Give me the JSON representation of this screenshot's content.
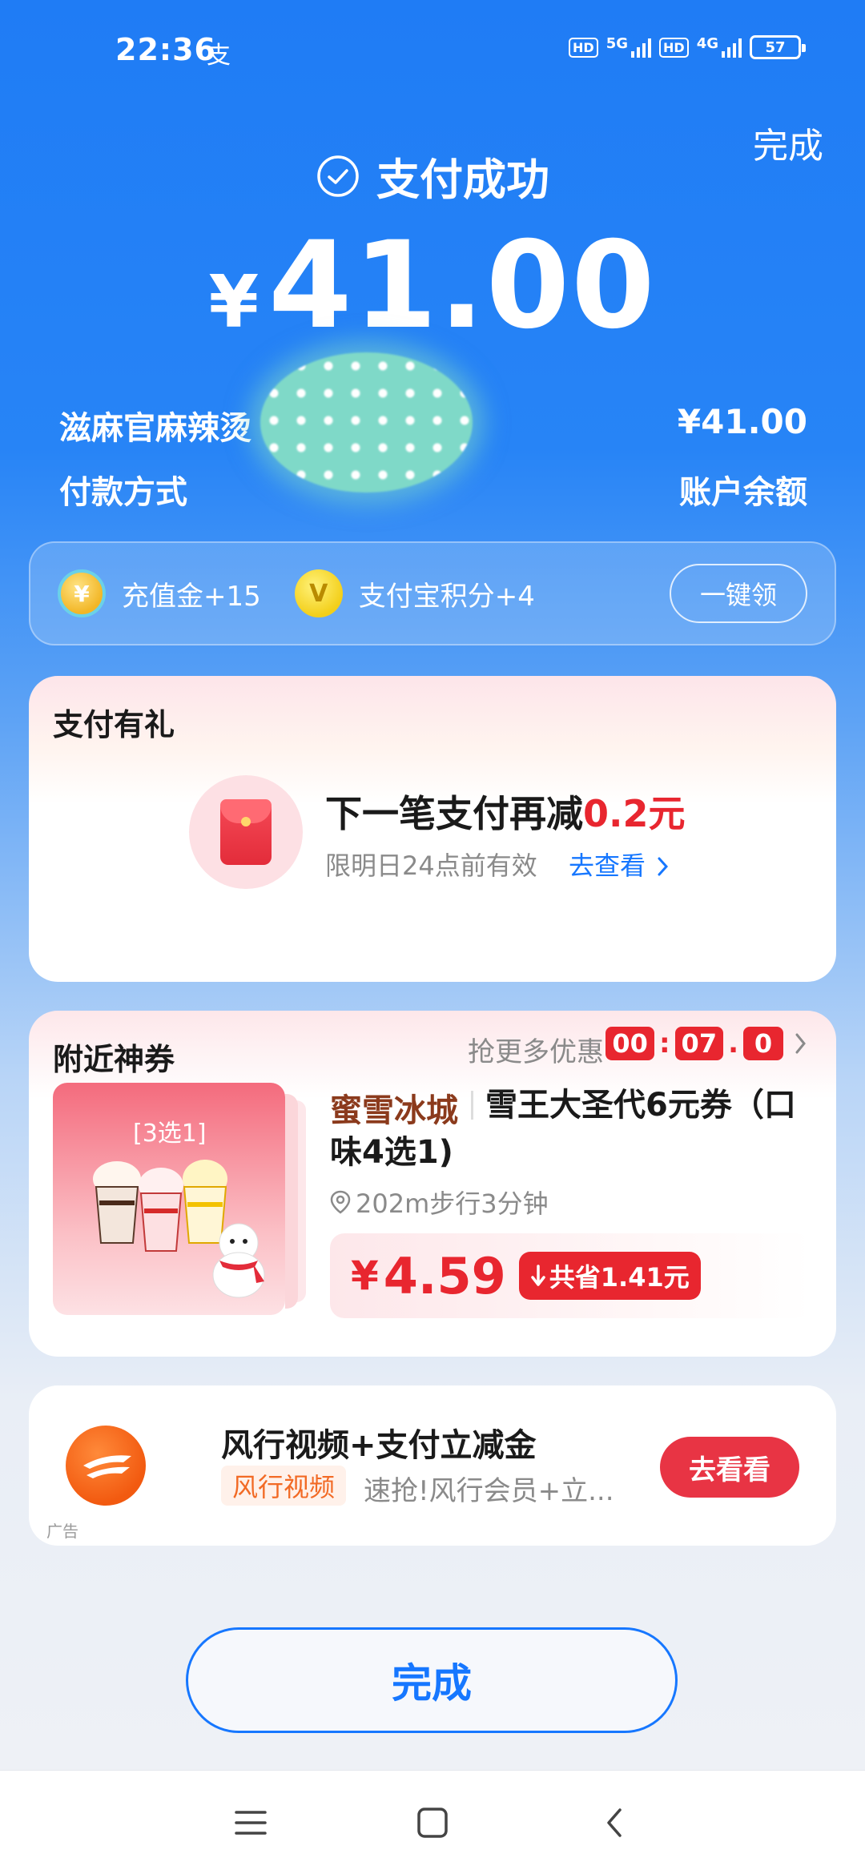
{
  "status_bar": {
    "time": "22:36",
    "app_indicator": "支",
    "hd1": "HD",
    "net1": "5G",
    "hd2": "HD",
    "net2": "4G",
    "battery": "57"
  },
  "header": {
    "done_label": "完成",
    "success_text": "支付成功",
    "currency_symbol": "¥",
    "amount": "41.00"
  },
  "details": {
    "merchant": "滋麻官麻辣烫",
    "paid_amount": "¥41.00",
    "pay_method_label": "付款方式",
    "pay_method_value": "账户余额"
  },
  "rewards": {
    "coin_icon_text": "¥",
    "recharge_text": "充值金+15",
    "points_icon_text": "V",
    "points_text": "支付宝积分+4",
    "claim_label": "一键领"
  },
  "gift_card": {
    "title": "支付有礼",
    "main_prefix": "下一笔支付再减",
    "main_highlight": "0.2元",
    "validity": "限明日24点前有效",
    "link": "去查看"
  },
  "coupon_card": {
    "title": "附近神券",
    "more_deals": "抢更多优惠",
    "timer": {
      "h": "00",
      "m": "07",
      "s": "0"
    },
    "product_tag": "[3选1]",
    "brand": "蜜雪冰城",
    "product_title_line1": "雪王大圣代6元券（口",
    "product_title_line2": "味4选1)",
    "distance": "202m步行3分钟",
    "price_symbol": "¥",
    "price": "4.59",
    "savings": "共省1.41元"
  },
  "ad_card": {
    "title": "风行视频+支付立减金",
    "tag": "风行视频",
    "desc": "速抢!风行会员+立...",
    "ad_flag": "广告",
    "button": "去看看"
  },
  "footer": {
    "done_label": "完成"
  },
  "colors": {
    "primary_blue": "#1677ff",
    "header_blue": "#1f7cf5",
    "accent_red": "#e8262f",
    "brand_brown": "#8b3a1c",
    "ad_orange": "#f26a25"
  },
  "icons": [
    "check-circle-icon",
    "coin-icon",
    "points-icon",
    "red-envelope-icon",
    "chevron-right-icon",
    "location-pin-icon",
    "down-arrow-icon",
    "menu-icon",
    "home-icon",
    "back-icon"
  ]
}
